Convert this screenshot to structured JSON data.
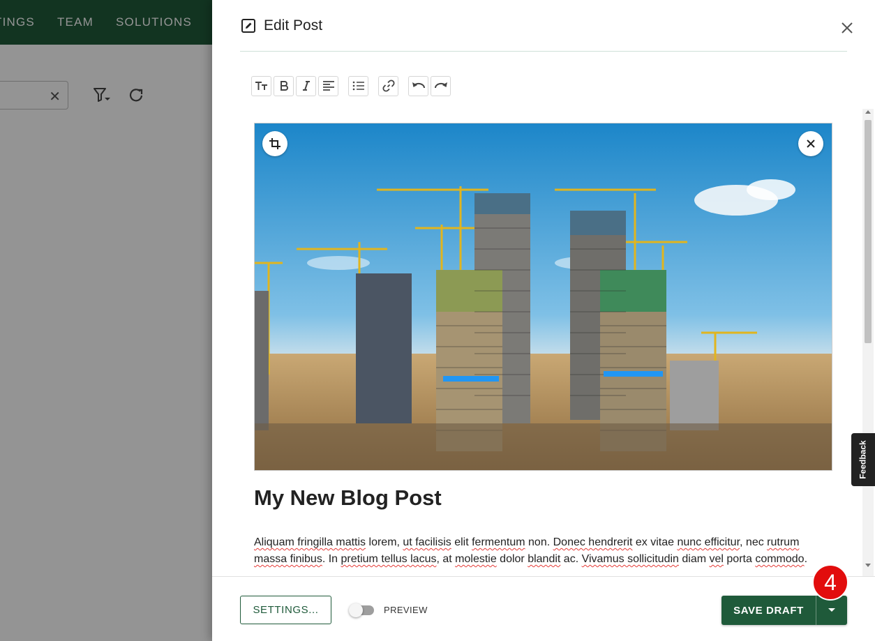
{
  "background": {
    "nav_items": [
      "TINGS",
      "TEAM",
      "SOLUTIONS"
    ],
    "search_clear_icon": "close-icon",
    "filter_icon": "filter-icon",
    "refresh_icon": "refresh-icon"
  },
  "drawer": {
    "title": "Edit Post",
    "title_icon": "edit-icon",
    "close_icon": "close-icon",
    "toolbar": [
      "text-size-icon",
      "bold-icon",
      "italic-icon",
      "align-left-icon",
      "list-icon",
      "link-icon",
      "undo-icon",
      "redo-icon"
    ],
    "image": {
      "crop_icon": "crop-icon",
      "remove_icon": "close-icon"
    },
    "post_title": "My New Blog Post",
    "body_line1": [
      {
        "t": "Aliquam fringilla mattis",
        "s": true
      },
      {
        "t": " lorem, ",
        "s": false
      },
      {
        "t": "ut facilisis",
        "s": true
      },
      {
        "t": " elit ",
        "s": false
      },
      {
        "t": "fermentum",
        "s": true
      },
      {
        "t": " non. ",
        "s": false
      },
      {
        "t": "Donec hendrerit",
        "s": true
      },
      {
        "t": " ex vitae ",
        "s": false
      },
      {
        "t": "nunc efficitur",
        "s": true
      },
      {
        "t": ", nec ",
        "s": false
      },
      {
        "t": "rutrum",
        "s": true
      }
    ],
    "body_line2": [
      {
        "t": "massa finibus",
        "s": true
      },
      {
        "t": ". In ",
        "s": false
      },
      {
        "t": "pretium tellus lacus",
        "s": true
      },
      {
        "t": ", at ",
        "s": false
      },
      {
        "t": "molestie",
        "s": true
      },
      {
        "t": " dolor ",
        "s": false
      },
      {
        "t": "blandit",
        "s": true
      },
      {
        "t": " ac. ",
        "s": false
      },
      {
        "t": "Vivamus sollicitudin",
        "s": true
      },
      {
        "t": " diam ",
        "s": false
      },
      {
        "t": "vel",
        "s": true
      },
      {
        "t": " porta ",
        "s": false
      },
      {
        "t": "commodo",
        "s": true
      },
      {
        "t": ".",
        "s": false
      }
    ],
    "footer": {
      "settings_label": "SETTINGS...",
      "preview_label": "PREVIEW",
      "preview_on": false,
      "save_label": "SAVE DRAFT",
      "dropdown_icon": "caret-down-icon",
      "step_badge": "4"
    },
    "feedback_label": "Feedback"
  },
  "colors": {
    "brand_green": "#1f5a3a",
    "badge_red": "#e20d0d"
  }
}
